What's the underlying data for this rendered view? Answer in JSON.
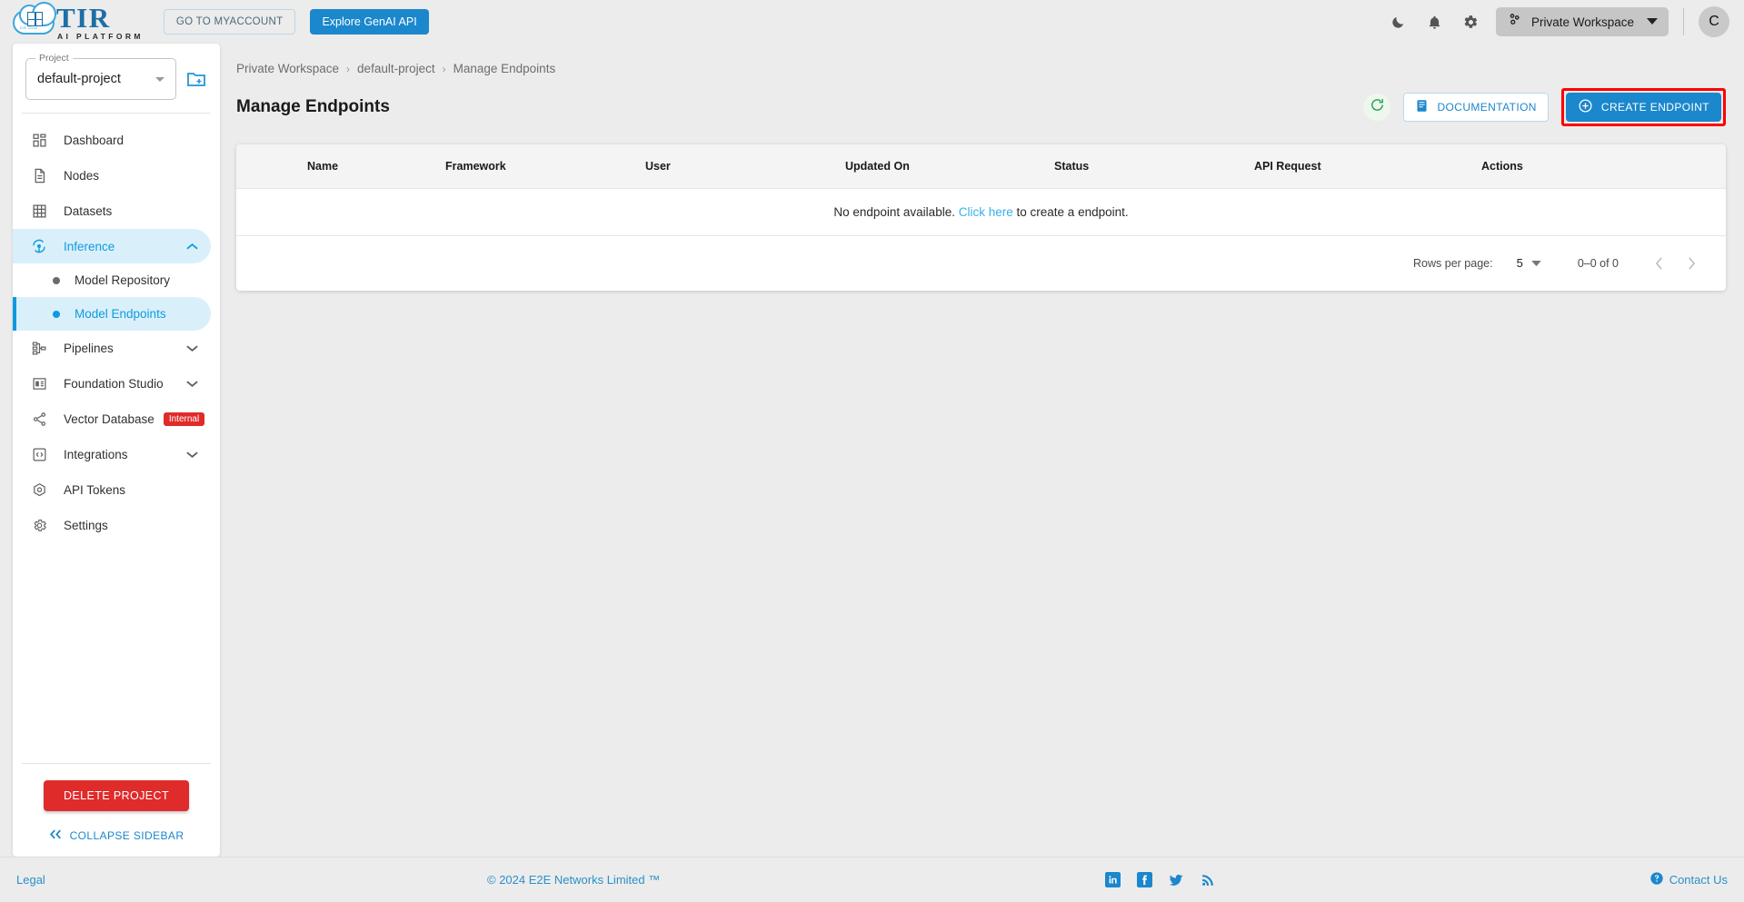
{
  "brand": {
    "logo_title": "TIR",
    "logo_subtitle": "AI PLATFORM",
    "logo_cloud_text": "E2E Cloud",
    "accent_blue": "#1b87cc",
    "danger_red": "#e02b2b",
    "highlight_red": "#ff0000"
  },
  "topbar": {
    "myaccount_label": "GO TO MYACCOUNT",
    "genai_label": "Explore GenAI API",
    "theme_icon": "moon-icon",
    "notifications_icon": "bell-icon",
    "settings_icon": "gear-icon",
    "workspace_icon": "workspace-nodes-icon",
    "workspace_label": "Private Workspace",
    "workspace_caret": "chevron-down-icon",
    "avatar_initial": "C"
  },
  "sidebar": {
    "project": {
      "legend": "Project",
      "value": "default-project",
      "new_project_icon": "new-folder-icon"
    },
    "items": [
      {
        "label": "Dashboard",
        "icon": "dashboard-icon",
        "active": false,
        "expandable": false
      },
      {
        "label": "Nodes",
        "icon": "file-icon",
        "active": false,
        "expandable": false
      },
      {
        "label": "Datasets",
        "icon": "grid-table-icon",
        "active": false,
        "expandable": false
      },
      {
        "label": "Inference",
        "icon": "inference-icon",
        "active": true,
        "expandable": true,
        "expanded": true
      },
      {
        "label": "Pipelines",
        "icon": "pipelines-icon",
        "active": false,
        "expandable": true,
        "expanded": false
      },
      {
        "label": "Foundation Studio",
        "icon": "foundation-studio-icon",
        "active": false,
        "expandable": true,
        "expanded": false
      },
      {
        "label": "Vector Database",
        "icon": "share-nodes-icon",
        "active": false,
        "expandable": false,
        "badge": "Internal"
      },
      {
        "label": "Integrations",
        "icon": "code-brackets-icon",
        "active": false,
        "expandable": true,
        "expanded": false
      },
      {
        "label": "API Tokens",
        "icon": "token-hex-icon",
        "active": false,
        "expandable": false
      },
      {
        "label": "Settings",
        "icon": "gear-icon",
        "active": false,
        "expandable": false
      }
    ],
    "sub_items": [
      {
        "label": "Model Repository",
        "active": false
      },
      {
        "label": "Model Endpoints",
        "active": true
      }
    ],
    "delete_label": "DELETE PROJECT",
    "collapse_label": "COLLAPSE SIDEBAR",
    "collapse_icon": "double-chevron-left-icon"
  },
  "main": {
    "breadcrumb": [
      "Private Workspace",
      "default-project",
      "Manage Endpoints"
    ],
    "breadcrumb_separator": "›",
    "page_title": "Manage Endpoints",
    "refresh_icon": "refresh-icon",
    "documentation_label": "DOCUMENTATION",
    "documentation_icon": "document-icon",
    "create_label": "CREATE ENDPOINT",
    "create_icon": "plus-circle-icon",
    "table": {
      "columns": [
        "Name",
        "Framework",
        "User",
        "Updated On",
        "Status",
        "API Request",
        "Actions"
      ],
      "rows": [],
      "empty_text_before": "No endpoint available.",
      "empty_link": "Click here",
      "empty_text_after": "to create a endpoint."
    },
    "pagination": {
      "rows_per_page_label": "Rows per page:",
      "rows_per_page_value": "5",
      "range_label": "0–0 of 0",
      "prev_icon": "chevron-left-icon",
      "next_icon": "chevron-right-icon"
    }
  },
  "footer": {
    "legal": "Legal",
    "copyright": "© 2024 E2E Networks Limited ™",
    "socials": [
      {
        "name": "linkedin-icon"
      },
      {
        "name": "facebook-icon"
      },
      {
        "name": "twitter-icon"
      },
      {
        "name": "rss-icon"
      }
    ],
    "contact_icon": "help-circle-icon",
    "contact_label": "Contact Us"
  }
}
